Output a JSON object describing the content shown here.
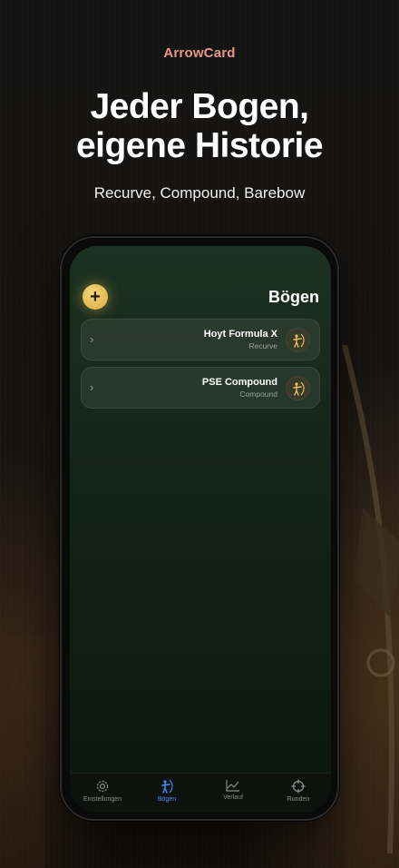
{
  "brand": "ArrowCard",
  "headline": {
    "line1": "Jeder Bogen,",
    "line2": "eigene Historie"
  },
  "subline": "Recurve, Compound, Barebow",
  "app": {
    "title": "Bögen",
    "add_icon": "plus-icon",
    "bows": [
      {
        "name": "Hoyt Formula X",
        "type": "Recurve",
        "icon": "archer-icon"
      },
      {
        "name": "PSE Compound",
        "type": "Compound",
        "icon": "archer-icon"
      }
    ],
    "tabs": [
      {
        "label": "Einstellungen",
        "icon": "gear-icon",
        "active": false
      },
      {
        "label": "Bögen",
        "icon": "archer-icon",
        "active": true
      },
      {
        "label": "Verlauf",
        "icon": "chart-icon",
        "active": false
      },
      {
        "label": "Runden",
        "icon": "crosshair-icon",
        "active": false
      }
    ]
  },
  "colors": {
    "brand": "#e7968b",
    "accent_gold": "#e8c15a",
    "tab_active": "#4a8cff"
  }
}
